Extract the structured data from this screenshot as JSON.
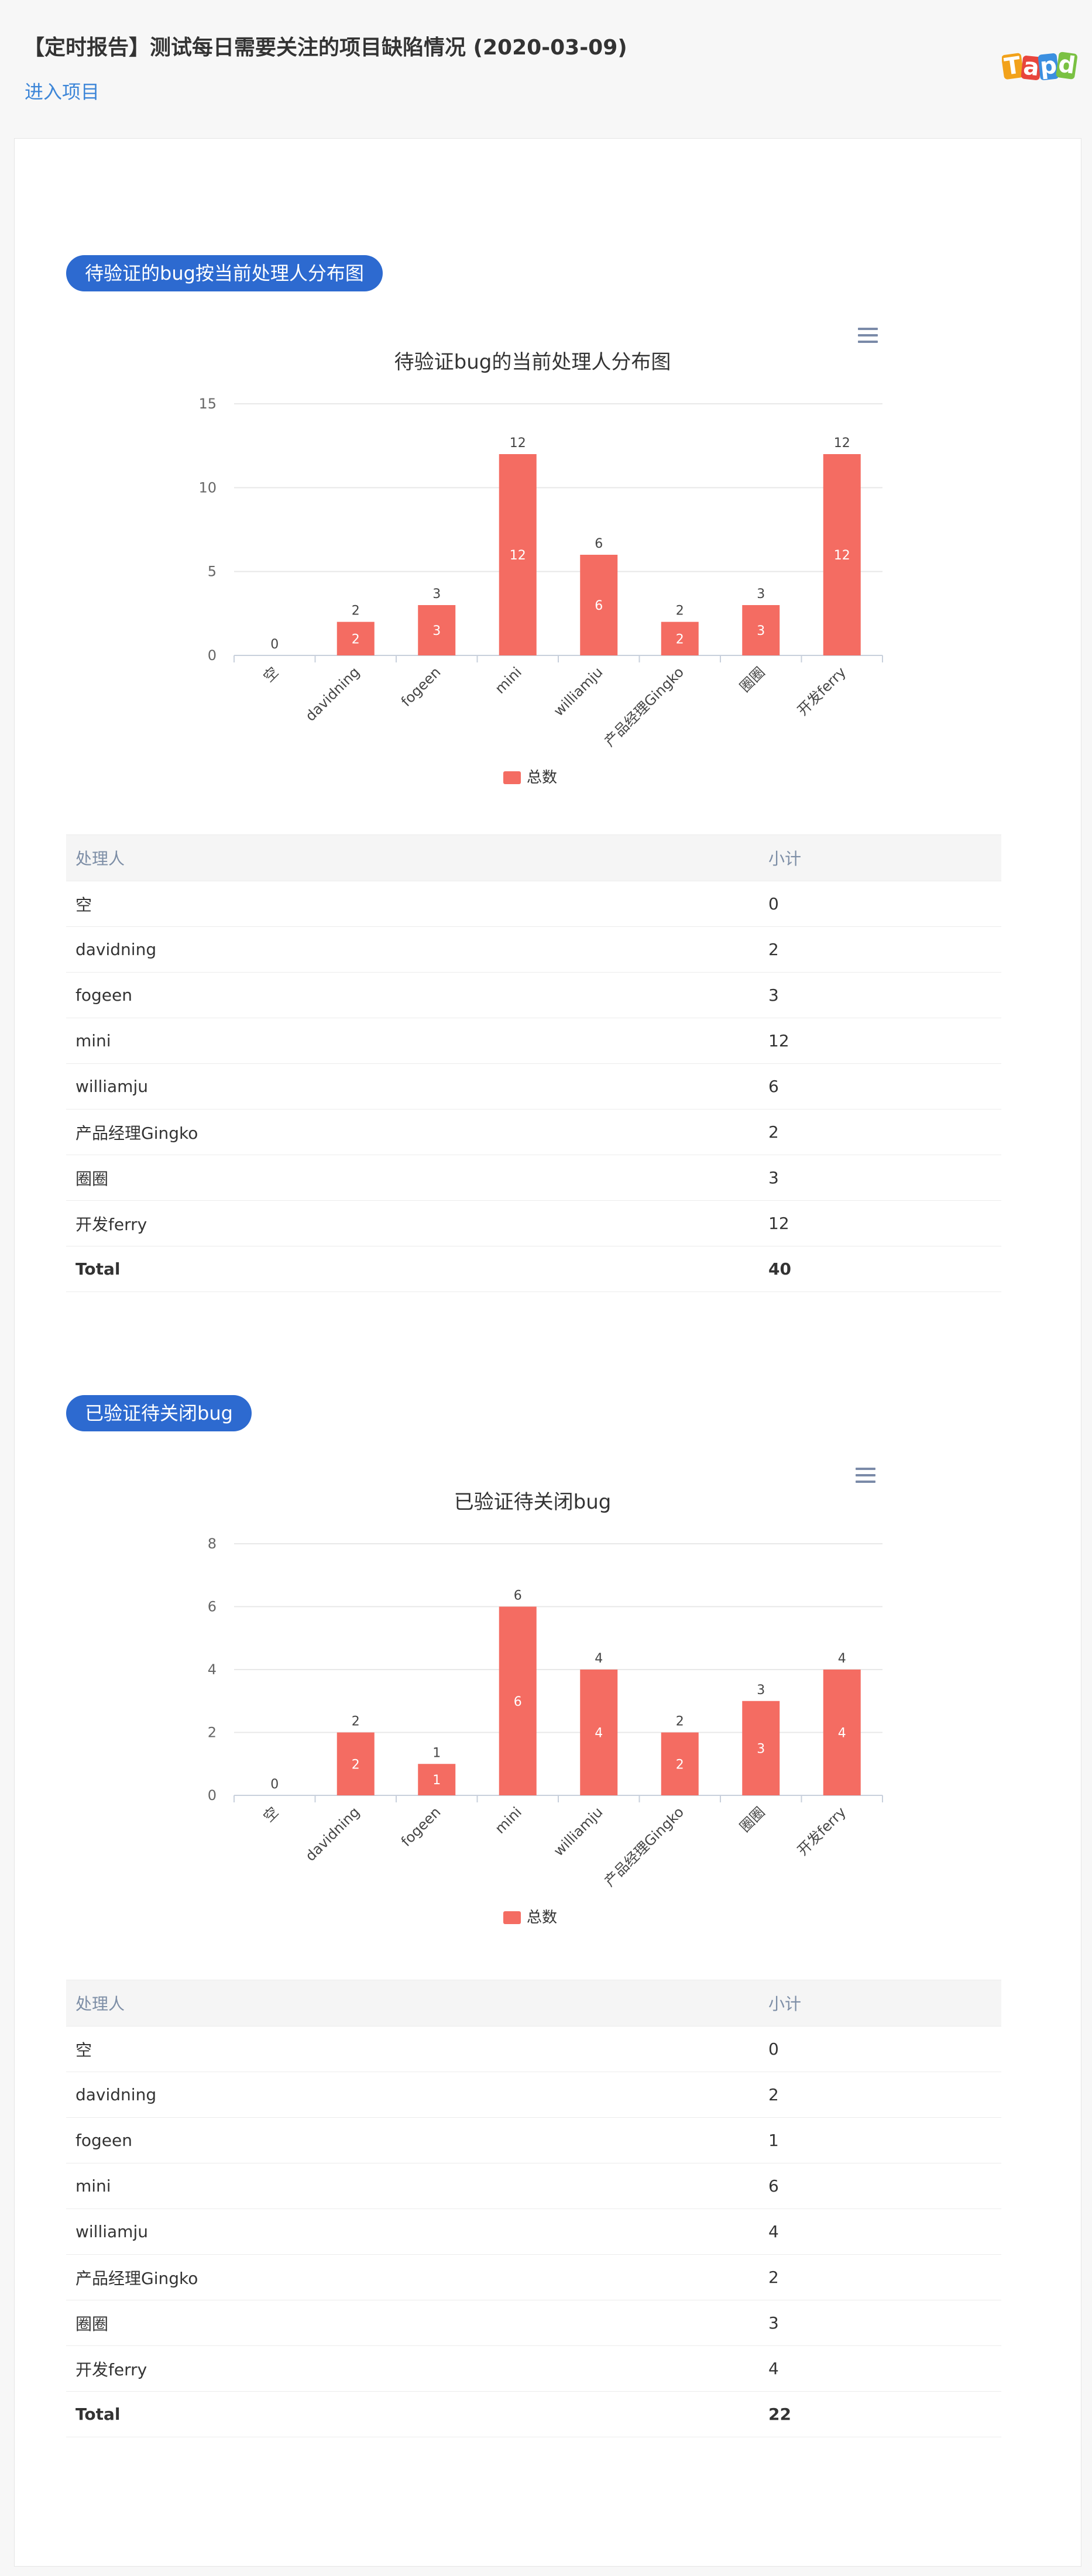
{
  "header": {
    "title": "【定时报告】测试每日需要关注的项目缺陷情况 (2020-03-09)",
    "enter_link": "进入项目",
    "logo_text": "Tapd"
  },
  "sections": [
    {
      "pill": "待验证的bug按当前处理人分布图",
      "table": {
        "headers": [
          "处理人",
          "小计"
        ],
        "rows": [
          [
            "空",
            "0"
          ],
          [
            "davidning",
            "2"
          ],
          [
            "fogeen",
            "3"
          ],
          [
            "mini",
            "12"
          ],
          [
            "williamju",
            "6"
          ],
          [
            "产品经理Gingko",
            "2"
          ],
          [
            "圈圈",
            "3"
          ],
          [
            "开发ferry",
            "12"
          ]
        ],
        "total": [
          "Total",
          "40"
        ]
      }
    },
    {
      "pill": "已验证待关闭bug",
      "table": {
        "headers": [
          "处理人",
          "小计"
        ],
        "rows": [
          [
            "空",
            "0"
          ],
          [
            "davidning",
            "2"
          ],
          [
            "fogeen",
            "1"
          ],
          [
            "mini",
            "6"
          ],
          [
            "williamju",
            "4"
          ],
          [
            "产品经理Gingko",
            "2"
          ],
          [
            "圈圈",
            "3"
          ],
          [
            "开发ferry",
            "4"
          ]
        ],
        "total": [
          "Total",
          "22"
        ]
      }
    }
  ],
  "chart_data": [
    {
      "type": "bar",
      "title": "待验证bug的当前处理人分布图",
      "categories": [
        "空",
        "davidning",
        "fogeen",
        "mini",
        "williamju",
        "产品经理Gingko",
        "圈圈",
        "开发ferry"
      ],
      "series": [
        {
          "name": "总数",
          "values": [
            0,
            2,
            3,
            12,
            6,
            2,
            3,
            12
          ],
          "color": "#f46c62"
        }
      ],
      "ylim": [
        0,
        15
      ],
      "yticks": [
        0,
        5,
        10,
        15
      ],
      "grid": true,
      "legend": "bottom-center"
    },
    {
      "type": "bar",
      "title": "已验证待关闭bug",
      "categories": [
        "空",
        "davidning",
        "fogeen",
        "mini",
        "williamju",
        "产品经理Gingko",
        "圈圈",
        "开发ferry"
      ],
      "series": [
        {
          "name": "总数",
          "values": [
            0,
            2,
            1,
            6,
            4,
            2,
            3,
            4
          ],
          "color": "#f46c62"
        }
      ],
      "ylim": [
        0,
        8
      ],
      "yticks": [
        0,
        2,
        4,
        6,
        8
      ],
      "grid": true,
      "legend": "bottom-center"
    }
  ]
}
